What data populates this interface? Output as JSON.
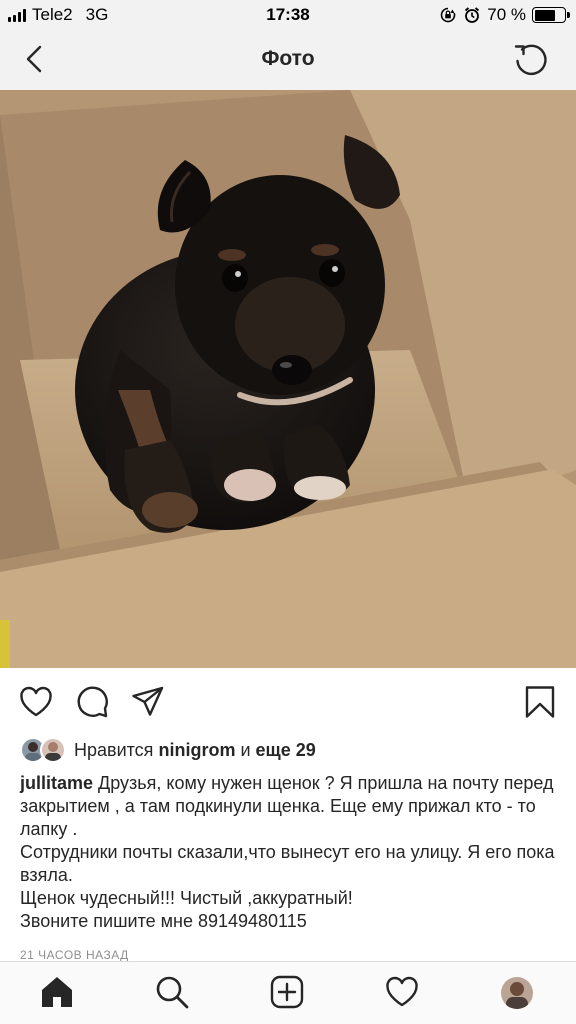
{
  "status_bar": {
    "carrier": "Tele2",
    "network": "3G",
    "time": "17:38",
    "battery": "70 %",
    "battery_level": 0.7
  },
  "header": {
    "title": "Фото",
    "back_icon": "chevron-left-icon",
    "refresh_icon": "refresh-icon"
  },
  "post": {
    "actions": [
      "heart-icon",
      "comment-icon",
      "share-icon",
      "bookmark-icon"
    ],
    "likes": {
      "prefix": "Нравится",
      "user": "ninigrom",
      "connector": "и",
      "others": "еще 29"
    },
    "caption": {
      "username": "jullitame",
      "lines": [
        "Друзья, кому нужен щенок ? Я пришла на почту перед закрытием , а там подкинули щенка. Еще ему прижал кто - то лапку .",
        "Сотрудники почты сказали,что вынесут его на улицу. Я его пока взяла.",
        "Щенок чудесный!!! Чистый ,аккуратный!",
        "Звоните пишите мне 89149480115"
      ]
    },
    "time_ago": "21 ЧАСОВ НАЗАД"
  },
  "tab_bar": {
    "items": [
      "home-icon",
      "search-icon",
      "new-post-icon",
      "activity-icon",
      "profile-avatar"
    ]
  }
}
